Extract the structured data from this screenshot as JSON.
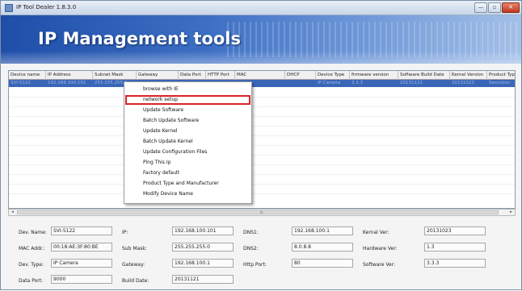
{
  "window": {
    "title": "IP Tool Dealer 1.8.3.0",
    "controls": {
      "minimize": "—",
      "maximize": "▫",
      "close": "✕"
    }
  },
  "banner": {
    "title": "IP Management tools"
  },
  "table": {
    "columns": [
      "Device name",
      "IP Address",
      "Subnet Mask",
      "Gateway",
      "Data Port",
      "HTTP Port",
      "MAC",
      "DHCP",
      "Device Type",
      "firmware version",
      "Software Build Date",
      "Kernel Version",
      "Product Type"
    ],
    "selected_row": [
      "SVI-5122",
      "192.168.100.101",
      "255.255.255.0",
      "",
      "",
      "",
      "",
      "",
      "IP Camera",
      "3.3.3",
      "20131121",
      "20131023",
      "Seevision"
    ]
  },
  "scrollbar": {
    "left_arrow": "◂",
    "right_arrow": "▸",
    "grip": "III"
  },
  "context_menu": {
    "items": [
      "browse with IE",
      "network setup",
      "Update Software",
      "Batch Update Software",
      "Update Kernel",
      "Batch Update Kernel",
      "Update Configuration Files",
      "Ping This Ip",
      "Factory default",
      "Product Type and Manufacturer",
      "Modify Device Name"
    ],
    "highlighted_index": 1
  },
  "details": {
    "dev_name": {
      "label": "Dev. Name:",
      "value": "SVI-5122"
    },
    "mac_addr": {
      "label": "MAC Addr.:",
      "value": "00:18:AE:3F:80:BE"
    },
    "dev_type": {
      "label": "Dev. Type:",
      "value": "IP Camera"
    },
    "data_port": {
      "label": "Data Port:",
      "value": "9000"
    },
    "ip": {
      "label": "IP:",
      "value": "192.168.100.101"
    },
    "sub_mask": {
      "label": "Sub Mask:",
      "value": "255.255.255.0"
    },
    "gateway": {
      "label": "Gateway:",
      "value": "192.168.100.1"
    },
    "build_date": {
      "label": "Build Date:",
      "value": "20131121"
    },
    "dns1": {
      "label": "DNS1:",
      "value": "192.168.100.1"
    },
    "dns2": {
      "label": "DNS2:",
      "value": "8.0.8.8"
    },
    "http_port": {
      "label": "Http Port:",
      "value": "80"
    },
    "kernel_ver": {
      "label": "Kernal Ver:",
      "value": "20131023"
    },
    "hardware_ver": {
      "label": "Hardware Ver:",
      "value": "1.3"
    },
    "software_ver": {
      "label": "Software Ver:",
      "value": "3.3.3"
    }
  }
}
